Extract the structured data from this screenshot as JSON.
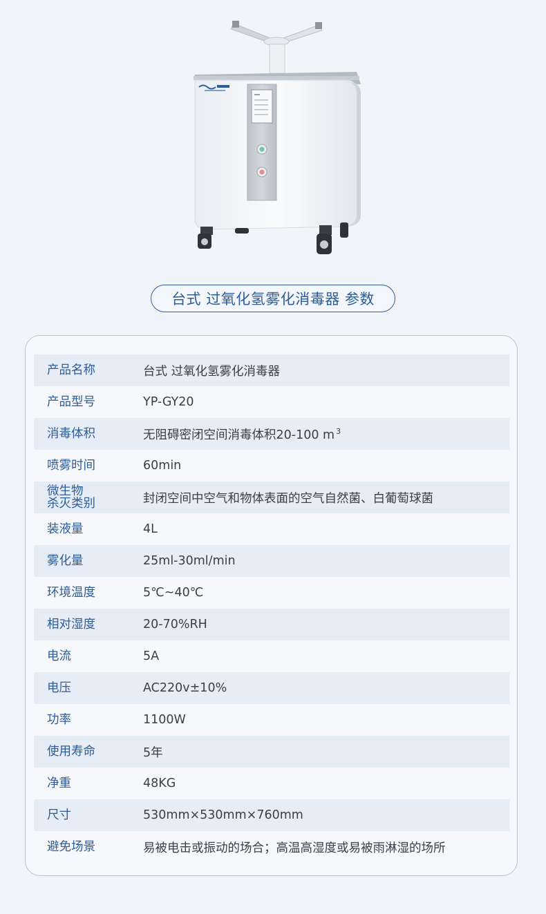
{
  "title": "台式 过氧化氢雾化消毒器 参数",
  "specs": [
    {
      "label": "产品名称",
      "value": "台式 过氧化氢雾化消毒器"
    },
    {
      "label": "产品型号",
      "value": "YP-GY20"
    },
    {
      "label": "消毒体积",
      "value": "无阻碍密闭空间消毒体积20-100 m",
      "sup": "3"
    },
    {
      "label": "喷雾时间",
      "value": "60min"
    },
    {
      "label": "微生物杀灭类别",
      "label_lines": [
        "微生物",
        "杀灭类别"
      ],
      "value": "封闭空间中空气和物体表面的空气自然菌、白葡萄球菌"
    },
    {
      "label": "装液量",
      "value": "4L"
    },
    {
      "label": "雾化量",
      "value": "25ml-30ml/min"
    },
    {
      "label": "环境温度",
      "value": "5℃~40℃"
    },
    {
      "label": "相对湿度",
      "value": "20-70%RH"
    },
    {
      "label": "电流",
      "value": "5A"
    },
    {
      "label": "电压",
      "value": "AC220v±10%"
    },
    {
      "label": "功率",
      "value": "1100W"
    },
    {
      "label": "使用寿命",
      "value": "5年"
    },
    {
      "label": "净重",
      "value": "48KG"
    },
    {
      "label": "尺寸",
      "value": "530mm×530mm×760mm"
    },
    {
      "label": "避免场景",
      "value": "易被电击或振动的场合；高温高湿度或易被雨淋湿的场所"
    }
  ],
  "colors": {
    "accent": "#2d5c98",
    "row_stripe": "#e6edf7",
    "background": "#f1f5fa"
  }
}
